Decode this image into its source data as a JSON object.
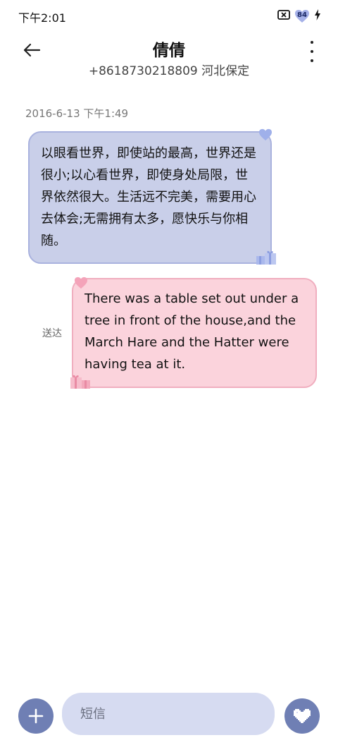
{
  "status_bar": {
    "time": "下午2:01",
    "battery_level": "84"
  },
  "header": {
    "contact_name": "倩倩",
    "contact_detail": "+8618730218809 河北保定"
  },
  "conversation": {
    "timestamp": "2016-6-13 下午1:49",
    "messages": [
      {
        "direction": "incoming",
        "text": "以眼看世界，即使站的最高，世界还是很小;以心看世界，即使身处局限，世界依然很大。生活远不完美，需要用心去体会;无需拥有太多，愿快乐与你相随。"
      },
      {
        "direction": "outgoing",
        "text": "There was a table set out under a tree in front of the house,and the March Hare and the Hatter were having tea at it.",
        "status": "送达"
      }
    ]
  },
  "composer": {
    "placeholder": "短信"
  },
  "colors": {
    "incoming_bubble": "#c9cfe9",
    "outgoing_bubble": "#fbd3dc",
    "accent": "#6f7fb4"
  }
}
